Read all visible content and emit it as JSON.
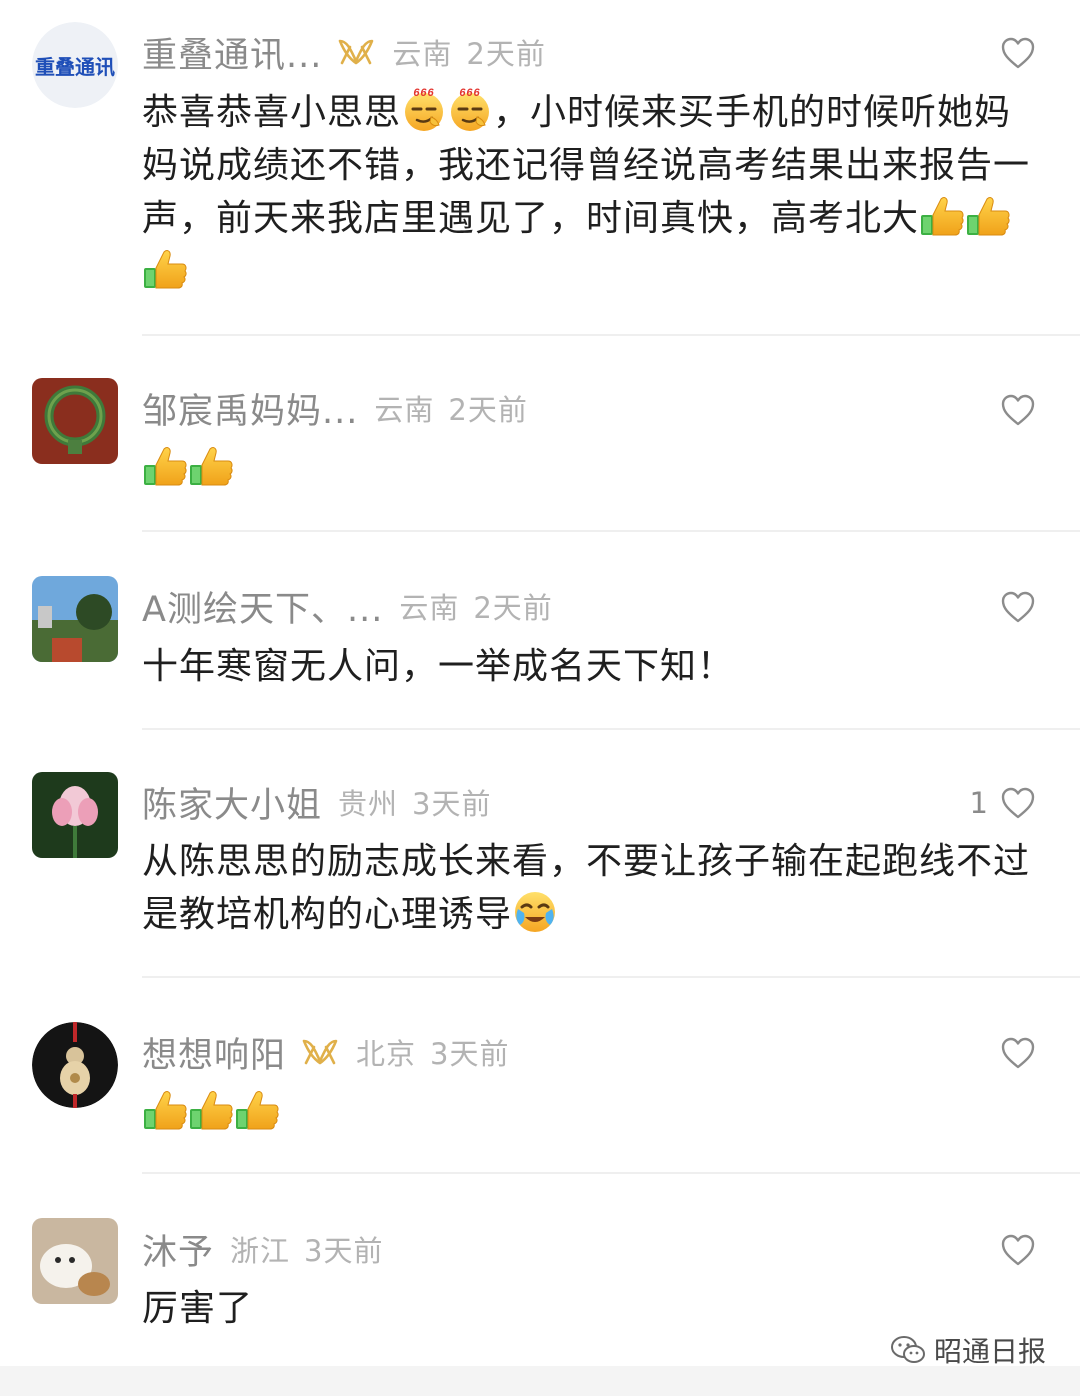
{
  "comments": [
    {
      "username": "重叠通讯...",
      "has_badge": true,
      "location": "云南",
      "time": "2天前",
      "like_count": "",
      "text_parts": [
        "恭喜恭喜小思思",
        "，小时候来买手机的时候听她妈妈说成绩还不错，我还记得曾经说高考结果出来报告一声，前天来我店里遇见了，时间真快，高考北大"
      ],
      "avatar_text": "重叠通讯"
    },
    {
      "username": "邹宸禹妈妈...",
      "has_badge": false,
      "location": "云南",
      "time": "2天前",
      "like_count": "",
      "text_parts": []
    },
    {
      "username": "A测绘天下、...",
      "has_badge": false,
      "location": "云南",
      "time": "2天前",
      "like_count": "",
      "text_parts": [
        "十年寒窗无人问，一举成名天下知！"
      ]
    },
    {
      "username": "陈家大小姐",
      "has_badge": false,
      "location": "贵州",
      "time": "3天前",
      "like_count": "1",
      "text_parts": [
        "从陈思思的励志成长来看，不要让孩子输在起跑线不过是教培机构的心理诱导"
      ]
    },
    {
      "username": "想想响阳",
      "has_badge": true,
      "location": "北京",
      "time": "3天前",
      "like_count": "",
      "text_parts": []
    },
    {
      "username": "沐予",
      "has_badge": false,
      "location": "浙江",
      "time": "3天前",
      "like_count": "",
      "text_parts": [
        "厉害了"
      ]
    }
  ],
  "emoji_labels": {
    "smirk_666": "666"
  },
  "watermark": {
    "text": "昭通日报"
  },
  "colors": {
    "username": "#8a8a8a",
    "meta": "#b3b3b3",
    "badge": "#e0b04a",
    "divider": "#efefef"
  }
}
